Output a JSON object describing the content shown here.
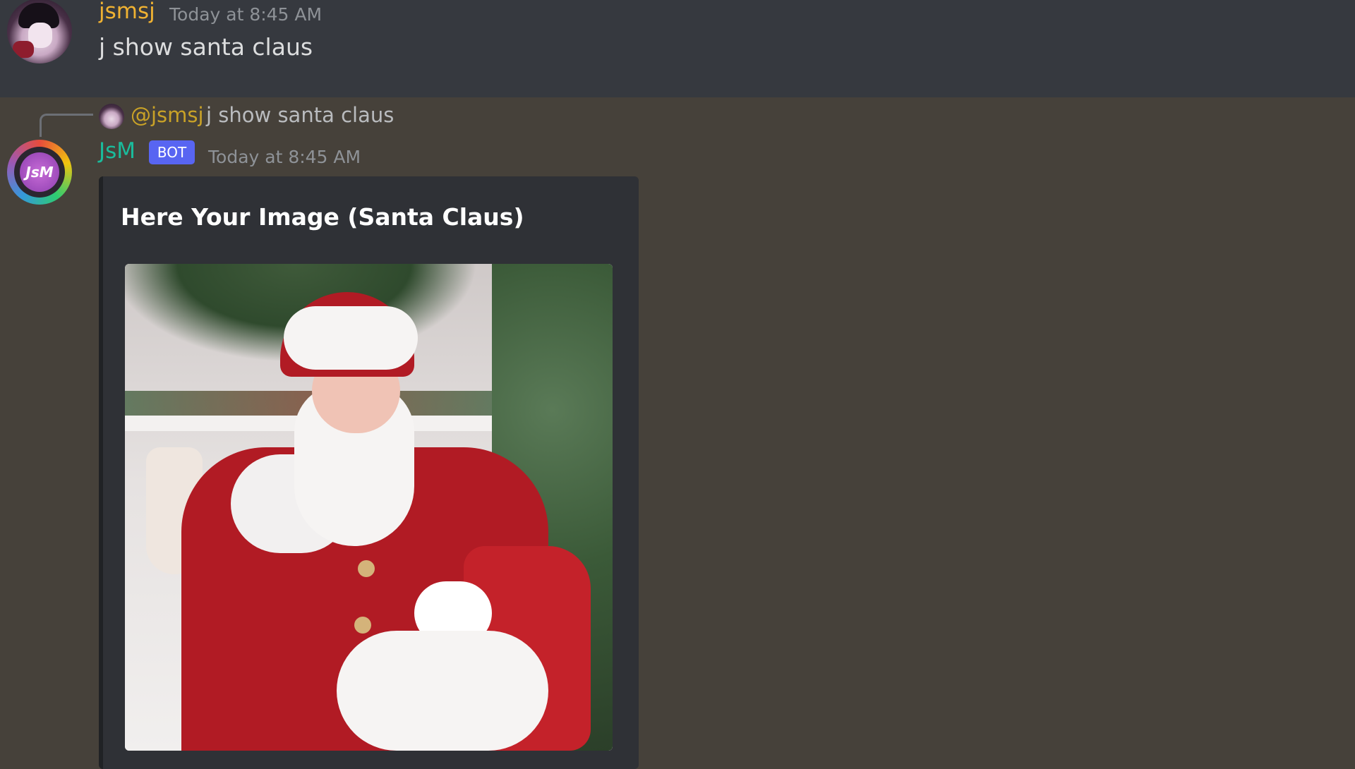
{
  "messages": {
    "first": {
      "username": "jsmsj",
      "timestamp": "Today at 8:45 AM",
      "content": "j show santa claus"
    },
    "reply": {
      "mention": "@jsmsj",
      "text": "j show santa claus"
    },
    "second": {
      "username": "JsM",
      "badge": "BOT",
      "timestamp": "Today at 8:45 AM",
      "embed": {
        "title": "Here Your Image (Santa Claus)"
      }
    }
  },
  "avatars": {
    "bot_logo_text": "JsM"
  },
  "colors": {
    "background_top": "#36393f",
    "background_bottom": "#46413a",
    "username_user": "#f0b232",
    "username_bot": "#1abc9c",
    "bot_badge": "#5865f2",
    "embed_bg": "#2f3136"
  }
}
